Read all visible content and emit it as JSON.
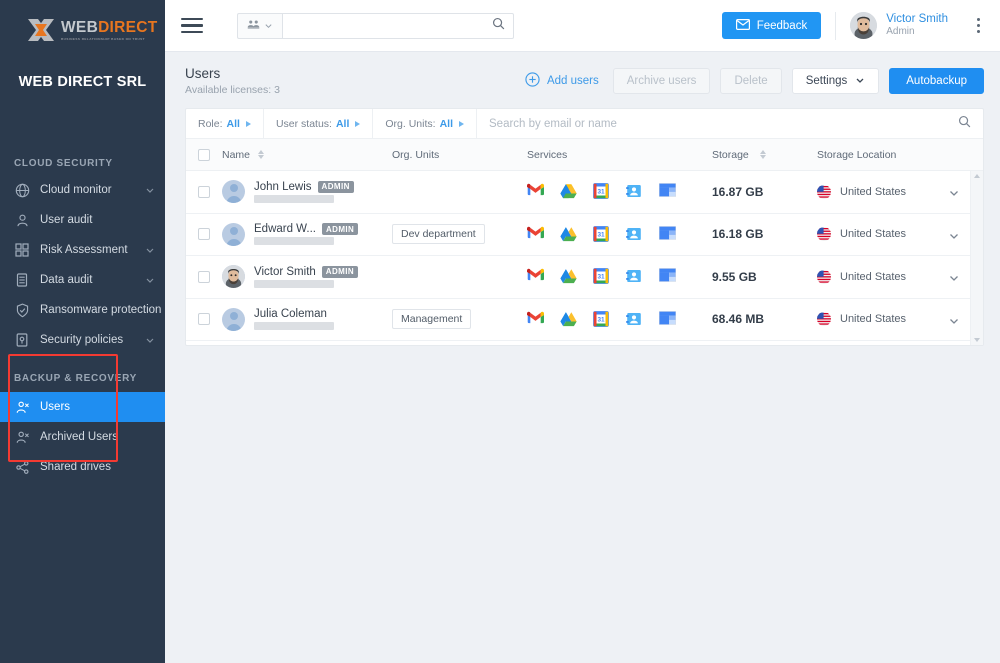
{
  "brand": {
    "logo_web": "WEB",
    "logo_direct": "DIRECT",
    "logo_tagline": "BUSINESS RELATIONSHIP BASED ON TRUST",
    "org_name": "WEB DIRECT SRL"
  },
  "sidebar": {
    "sections": [
      {
        "title": "CLOUD SECURITY",
        "items": [
          {
            "label": "Cloud monitor",
            "icon": "globe-icon",
            "chevron": true,
            "active": false
          },
          {
            "label": "User audit",
            "icon": "person-icon",
            "chevron": false,
            "active": false
          },
          {
            "label": "Risk Assessment",
            "icon": "grid-icon",
            "chevron": true,
            "active": false
          },
          {
            "label": "Data audit",
            "icon": "database-icon",
            "chevron": true,
            "active": false
          },
          {
            "label": "Ransomware protection",
            "icon": "shield-check-icon",
            "chevron": false,
            "active": false
          },
          {
            "label": "Security policies",
            "icon": "policy-icon",
            "chevron": true,
            "active": false
          }
        ]
      },
      {
        "title": "BACKUP & RECOVERY",
        "items": [
          {
            "label": "Users",
            "icon": "users-icon",
            "chevron": false,
            "active": true
          },
          {
            "label": "Archived Users",
            "icon": "archived-users-icon",
            "chevron": false,
            "active": false
          },
          {
            "label": "Shared drives",
            "icon": "share-icon",
            "chevron": false,
            "active": false
          }
        ]
      }
    ],
    "highlight_color": "#f43a32",
    "active_color": "#1f8ef1",
    "background": "#2b3a4d"
  },
  "topbar": {
    "menu_icon": "hamburger-icon",
    "scope_icon": "group-icon",
    "scope_chevron": "chevron-down-icon",
    "search_value": "",
    "search_placeholder": "",
    "search_icon": "search-icon",
    "feedback_label": "Feedback",
    "feedback_icon": "envelope-icon",
    "account_name": "Victor Smith",
    "account_role": "Admin",
    "more_icon": "kebab-menu-icon"
  },
  "page": {
    "title": "Users",
    "subtitle": "Available licenses: 3",
    "actions": {
      "add_users": "Add users",
      "add_users_icon": "plus-circle-icon",
      "archive_users": "Archive users",
      "delete": "Delete",
      "settings": "Settings",
      "settings_chevron": "chevron-down-icon",
      "autobackup": "Autobackup"
    }
  },
  "filters": [
    {
      "label": "Role:",
      "value": "All"
    },
    {
      "label": "User status:",
      "value": "All"
    },
    {
      "label": "Org. Units:",
      "value": "All"
    }
  ],
  "table": {
    "search_placeholder": "Search by email or name",
    "search_value": "",
    "columns": [
      {
        "key": "name",
        "label": "Name",
        "sortable": true
      },
      {
        "key": "org",
        "label": "Org. Units",
        "sortable": false
      },
      {
        "key": "services",
        "label": "Services",
        "sortable": false
      },
      {
        "key": "storage",
        "label": "Storage",
        "sortable": true
      },
      {
        "key": "location",
        "label": "Storage Location",
        "sortable": false
      }
    ],
    "services_icons": [
      "gmail-icon",
      "google-drive-icon",
      "google-calendar-icon",
      "google-contacts-icon",
      "google-sites-icon"
    ],
    "rows": [
      {
        "name": "John Lewis",
        "badge": "ADMIN",
        "email_redacted": true,
        "avatar": "placeholder",
        "org_unit": "",
        "storage": "16.87 GB",
        "location": "United States",
        "flag": "us-flag-icon",
        "checked": false
      },
      {
        "name": "Edward W...",
        "badge": "ADMIN",
        "email_redacted": true,
        "avatar": "placeholder",
        "org_unit": "Dev department",
        "storage": "16.18 GB",
        "location": "United States",
        "flag": "us-flag-icon",
        "checked": false
      },
      {
        "name": "Victor Smith",
        "badge": "ADMIN",
        "email_redacted": true,
        "avatar": "photo",
        "org_unit": "",
        "storage": "9.55 GB",
        "location": "United States",
        "flag": "us-flag-icon",
        "checked": false
      },
      {
        "name": "Julia Coleman",
        "badge": "",
        "email_redacted": true,
        "avatar": "placeholder",
        "org_unit": "Management",
        "storage": "68.46 MB",
        "location": "United States",
        "flag": "us-flag-icon",
        "checked": false
      }
    ]
  }
}
